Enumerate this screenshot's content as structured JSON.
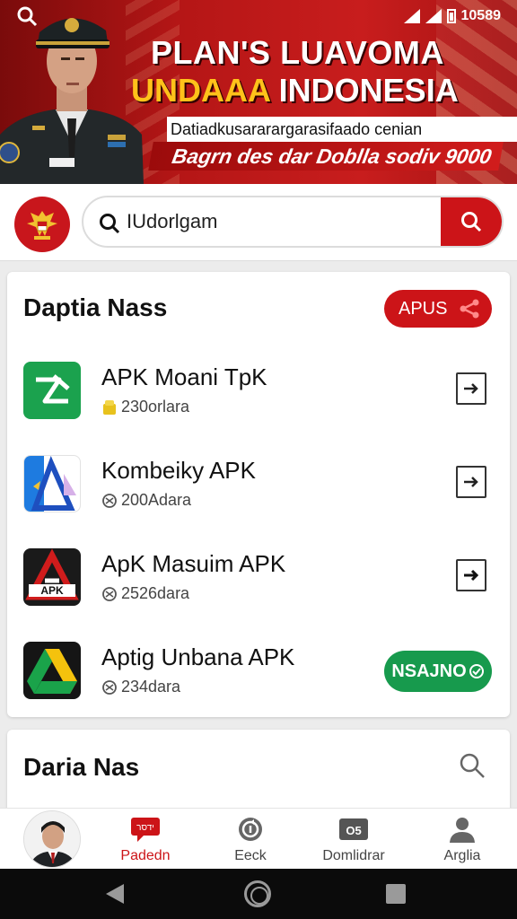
{
  "status_bar": {
    "time": "10589"
  },
  "banner": {
    "title_line1": "PLAN'S LUAVOMA",
    "title_line2_a": "UNDAAA",
    "title_line2_b": "INDONESIA",
    "subtitle": "Datiadkusararargarasifaado cenian",
    "tagline": "Bagrn des dar Doblla sodiv 9000",
    "colors": {
      "red": "#c81d1d",
      "gold": "#ffc21a"
    }
  },
  "search": {
    "value": "IUdorlgam"
  },
  "app_list": {
    "title": "Daptia Nass",
    "action_label": "APUS",
    "items": [
      {
        "name": "APK Moani TpK",
        "meta": "230orlara",
        "meta_icon": "coin-icon",
        "action": "open"
      },
      {
        "name": "Kombeiky APK",
        "meta": "200Adara",
        "meta_icon": "download-badge-icon",
        "action": "open"
      },
      {
        "name": "ApK Masuim APK",
        "meta": "2526dara",
        "meta_icon": "download-badge-icon",
        "action": "open"
      },
      {
        "name": "Aptig Unbana APK",
        "meta": "234dara",
        "meta_icon": "download-badge-icon",
        "action": "NSAJNO"
      }
    ]
  },
  "section2": {
    "title": "Daria Nas"
  },
  "bottom_nav": {
    "items": [
      {
        "label": "Padedn",
        "icon": "chat-icon",
        "active": true
      },
      {
        "label": "Eeck",
        "icon": "refresh-icon",
        "active": false
      },
      {
        "label": "Domlidrar",
        "icon": "id-card-icon",
        "active": false
      },
      {
        "label": "Arglia",
        "icon": "person-icon",
        "active": false
      }
    ],
    "nav_icon_texts": {
      "chat": "ידסר",
      "id": "O5"
    }
  }
}
